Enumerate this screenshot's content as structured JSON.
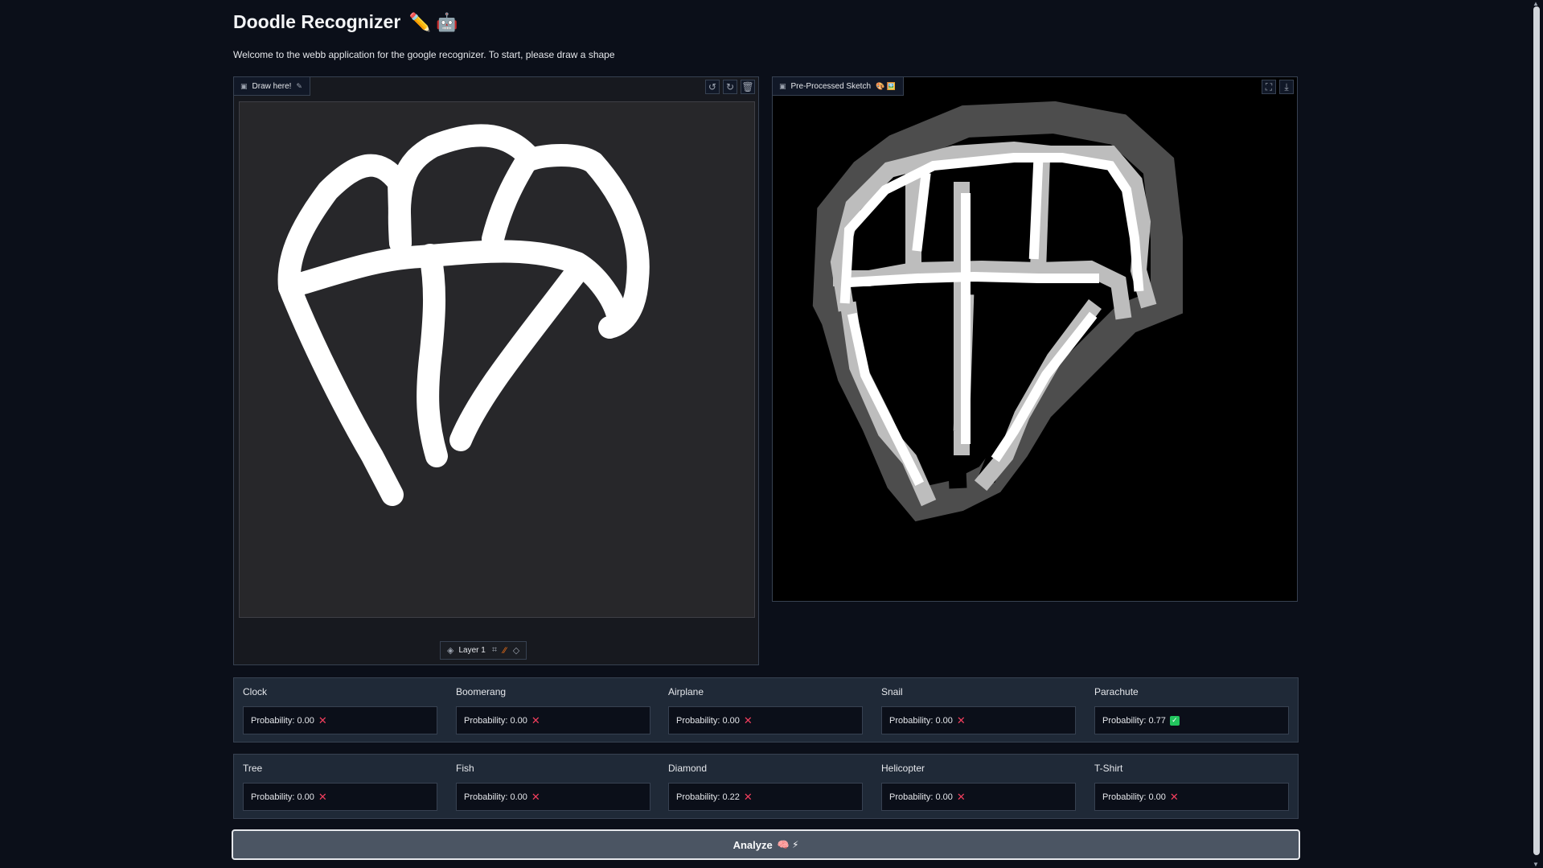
{
  "header": {
    "title": "Doodle Recognizer",
    "title_emoji": "✏️ 🤖",
    "subtitle": "Welcome to the webb application for the google recognizer. To start, please draw a shape"
  },
  "draw_panel": {
    "label": "Draw here!",
    "label_icon": "brush-icon",
    "layer_label": "Layer 1",
    "tools": [
      "undo-icon",
      "redo-icon",
      "trash-icon"
    ],
    "bottom_tools": [
      "crop-icon",
      "brush-icon",
      "eraser-icon"
    ]
  },
  "processed_panel": {
    "label": "Pre-Processed Sketch",
    "label_emoji": "🎨 🖼️",
    "tools": [
      "fullscreen-icon",
      "download-icon"
    ]
  },
  "results": {
    "row1": [
      {
        "name": "Clock",
        "text": "Probability: 0.00",
        "status": "no"
      },
      {
        "name": "Boomerang",
        "text": "Probability: 0.00",
        "status": "no"
      },
      {
        "name": "Airplane",
        "text": "Probability: 0.00",
        "status": "no"
      },
      {
        "name": "Snail",
        "text": "Probability: 0.00",
        "status": "no"
      },
      {
        "name": "Parachute",
        "text": "Probability: 0.77",
        "status": "yes"
      }
    ],
    "row2": [
      {
        "name": "Tree",
        "text": "Probability: 0.00",
        "status": "no"
      },
      {
        "name": "Fish",
        "text": "Probability: 0.00",
        "status": "no"
      },
      {
        "name": "Diamond",
        "text": "Probability: 0.22",
        "status": "no"
      },
      {
        "name": "Helicopter",
        "text": "Probability: 0.00",
        "status": "no"
      },
      {
        "name": "T-Shirt",
        "text": "Probability: 0.00",
        "status": "no"
      }
    ]
  },
  "analyze_button": {
    "label": "Analyze",
    "emoji": "🧠 ⚡"
  },
  "colors": {
    "background": "#0b0f19",
    "panel": "#1f2937",
    "border": "#374151",
    "cross": "#f43f5e",
    "check": "#22c55e"
  }
}
